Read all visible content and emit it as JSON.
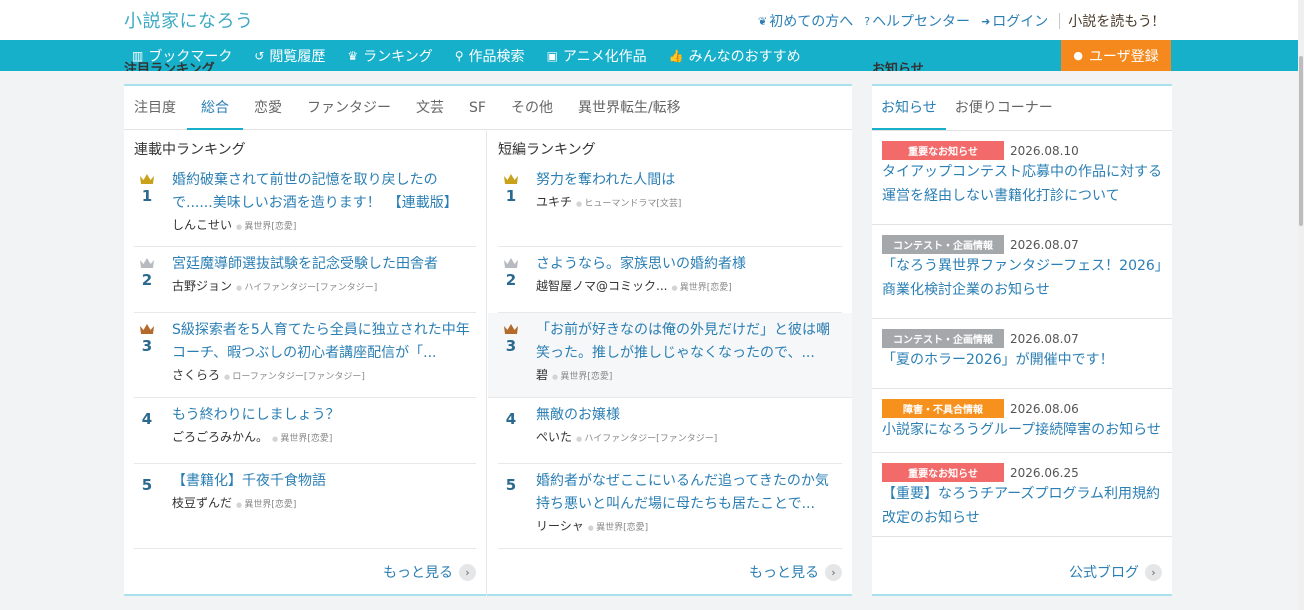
{
  "header": {
    "logo": "小説家になろう",
    "links": [
      {
        "icon": "leaf-icon",
        "glyph": "❦",
        "label": "初めての方へ"
      },
      {
        "icon": "help-icon",
        "glyph": "?",
        "label": "ヘルプセンター"
      },
      {
        "icon": "login-icon",
        "glyph": "➜",
        "label": "ログイン"
      }
    ],
    "yomou": "小説を読もう!"
  },
  "nav": {
    "items": [
      {
        "icon": "bookmark-icon",
        "glyph": "▥",
        "label": "ブックマーク"
      },
      {
        "icon": "history-icon",
        "glyph": "↺",
        "label": "閲覧履歴"
      },
      {
        "icon": "crown-icon",
        "glyph": "♛",
        "label": "ランキング"
      },
      {
        "icon": "search-icon",
        "glyph": "⚲",
        "label": "作品検索"
      },
      {
        "icon": "tv-icon",
        "glyph": "▣",
        "label": "アニメ化作品"
      },
      {
        "icon": "thumbs-up-icon",
        "glyph": "👍",
        "label": "みんなのおすすめ"
      }
    ],
    "register": {
      "icon": "user-icon",
      "glyph": "●",
      "label": "ユーザ登録"
    }
  },
  "ranking": {
    "clipped_title": "注目ランキング",
    "tabs": [
      "注目度",
      "総合",
      "恋愛",
      "ファンタジー",
      "文芸",
      "SF",
      "その他",
      "異世界転生/転移"
    ],
    "active_tab": "総合",
    "serial": {
      "heading": "連載中ランキング",
      "items": [
        {
          "rank": "1",
          "crown": "#c9a21c",
          "title": "婚約破棄されて前世の記憶を取り戻したので......美味しいお酒を造ります！　【連載版】",
          "author": "しんこせい",
          "genre": "異世界[恋愛]"
        },
        {
          "rank": "2",
          "crown": "#b7bbbf",
          "title": "宮廷魔導師選抜試験を記念受験した田舎者",
          "author": "古野ジョン",
          "genre": "ハイファンタジー[ファンタジー]"
        },
        {
          "rank": "3",
          "crown": "#b46a2a",
          "title": "S級探索者を5人育てたら全員に独立された中年コーチ、暇つぶしの初心者講座配信が「...",
          "author": "さくらろ",
          "genre": "ローファンタジー[ファンタジー]"
        },
        {
          "rank": "4",
          "crown": "",
          "title": "もう終わりにしましょう？",
          "author": "ごろごろみかん。",
          "genre": "異世界[恋愛]"
        },
        {
          "rank": "5",
          "crown": "",
          "title": "【書籍化】千夜千食物語",
          "author": "枝豆ずんだ",
          "genre": "異世界[恋愛]"
        }
      ],
      "more": "もっと見る"
    },
    "short": {
      "heading": "短編ランキング",
      "items": [
        {
          "rank": "1",
          "crown": "#c9a21c",
          "title": "努力を奪われた人間は",
          "author": "ユキチ",
          "genre": "ヒューマンドラマ[文芸]"
        },
        {
          "rank": "2",
          "crown": "#b7bbbf",
          "title": "さようなら。家族思いの婚約者様",
          "author": "越智屋ノマ@コミック...",
          "genre": "異世界[恋愛]"
        },
        {
          "rank": "3",
          "crown": "#b46a2a",
          "title": "「お前が好きなのは俺の外見だけだ」と彼は嘲笑った。推しが推しじゃなくなったので、...",
          "author": "碧",
          "genre": "異世界[恋愛]"
        },
        {
          "rank": "4",
          "crown": "",
          "title": "無敵のお嬢様",
          "author": "ぺいた",
          "genre": "ハイファンタジー[ファンタジー]"
        },
        {
          "rank": "5",
          "crown": "",
          "title": "婚約者がなぜここにいるんだ追ってきたのか気持ち悪いと叫んだ場に母たちも居たことで...",
          "author": "リーシャ",
          "genre": "異世界[恋愛]"
        }
      ],
      "more": "もっと見る"
    }
  },
  "news": {
    "clipped_title": "お知らせ",
    "tabs": [
      "お知らせ",
      "お便りコーナー"
    ],
    "items": [
      {
        "badge": "重要なお知らせ",
        "badge_color": "#f26a6a",
        "date": "2026.08.10",
        "text": "タイアップコンテスト応募中の作品に対する運営を経由しない書籍化打診について"
      },
      {
        "badge": "コンテスト・企画情報",
        "badge_color": "#a5a8ab",
        "date": "2026.08.07",
        "text": "「なろう異世界ファンタジーフェス！2026」商業化検討企業のお知らせ"
      },
      {
        "badge": "コンテスト・企画情報",
        "badge_color": "#a5a8ab",
        "date": "2026.08.07",
        "text": "「夏のホラー2026」が開催中です！"
      },
      {
        "badge": "障害・不具合情報",
        "badge_color": "#f7911d",
        "date": "2026.08.06",
        "text": "小説家になろうグループ接続障害のお知らせ"
      },
      {
        "badge": "重要なお知らせ",
        "badge_color": "#f26a6a",
        "date": "2026.06.25",
        "text": "【重要】なろうチアーズプログラム利用規約改定のお知らせ"
      }
    ],
    "blog": "公式ブログ"
  }
}
